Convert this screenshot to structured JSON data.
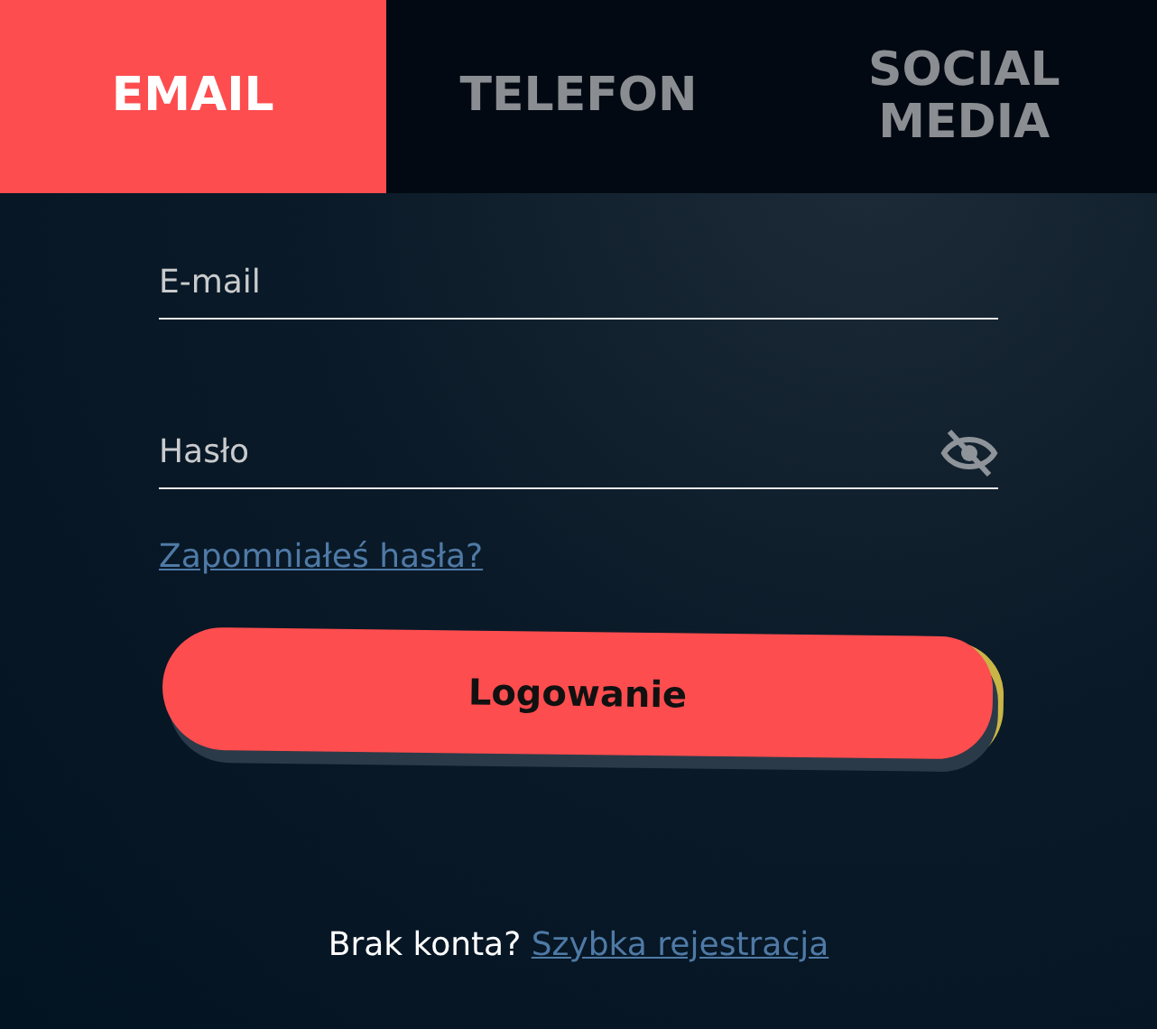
{
  "tabs": [
    {
      "label": "EMAIL",
      "selected": true
    },
    {
      "label": "TELEFON",
      "selected": false
    },
    {
      "label": "SOCIAL MEDIA",
      "selected": false
    }
  ],
  "form": {
    "fields": [
      {
        "kind": "text",
        "placeholder": "E-mail"
      },
      {
        "kind": "password",
        "placeholder": "Hasło"
      }
    ],
    "forgot_link": "Zapomniałeś hasła?",
    "submit": "Logowanie"
  },
  "footer": {
    "text": "Brak konta?",
    "link": "Szybka rejestracja"
  }
}
